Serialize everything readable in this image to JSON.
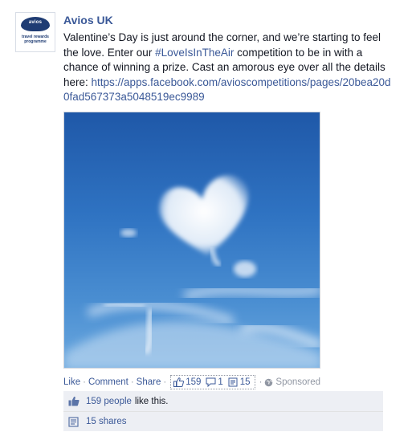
{
  "post": {
    "author": "Avios UK",
    "avatar": {
      "logo_word": "avios",
      "tagline_line1": "travel rewards",
      "tagline_line2": "programme"
    },
    "message_part1": "Valentine’s Day is just around the corner, and we’re starting to feel the love. Enter our ",
    "hashtag": "#LoveIsInTheAir",
    "message_part2": " competition to be in with a chance of winning a prize. Cast an amorous eye over all the details here: ",
    "url": "https://apps.facebook.com/avioscompetitions/pages/20bea20d0fad567373a5048519ec9989"
  },
  "actions": {
    "like": "Like",
    "comment": "Comment",
    "share": "Share",
    "sep": "·",
    "likes_count": "159",
    "comments_count": "1",
    "shares_count": "15",
    "sponsored": "Sponsored"
  },
  "ufi": {
    "likes_link": "159 people",
    "likes_suffix": "like this.",
    "shares_link": "15 shares"
  },
  "icons": {
    "like": "thumbs-up-icon",
    "comment": "comment-bubble-icon",
    "share": "share-icon",
    "sponsored": "globe-icon"
  },
  "colors": {
    "link": "#3b5998",
    "sky": "#2f73c2",
    "ufi_bg": "#edeff4"
  }
}
